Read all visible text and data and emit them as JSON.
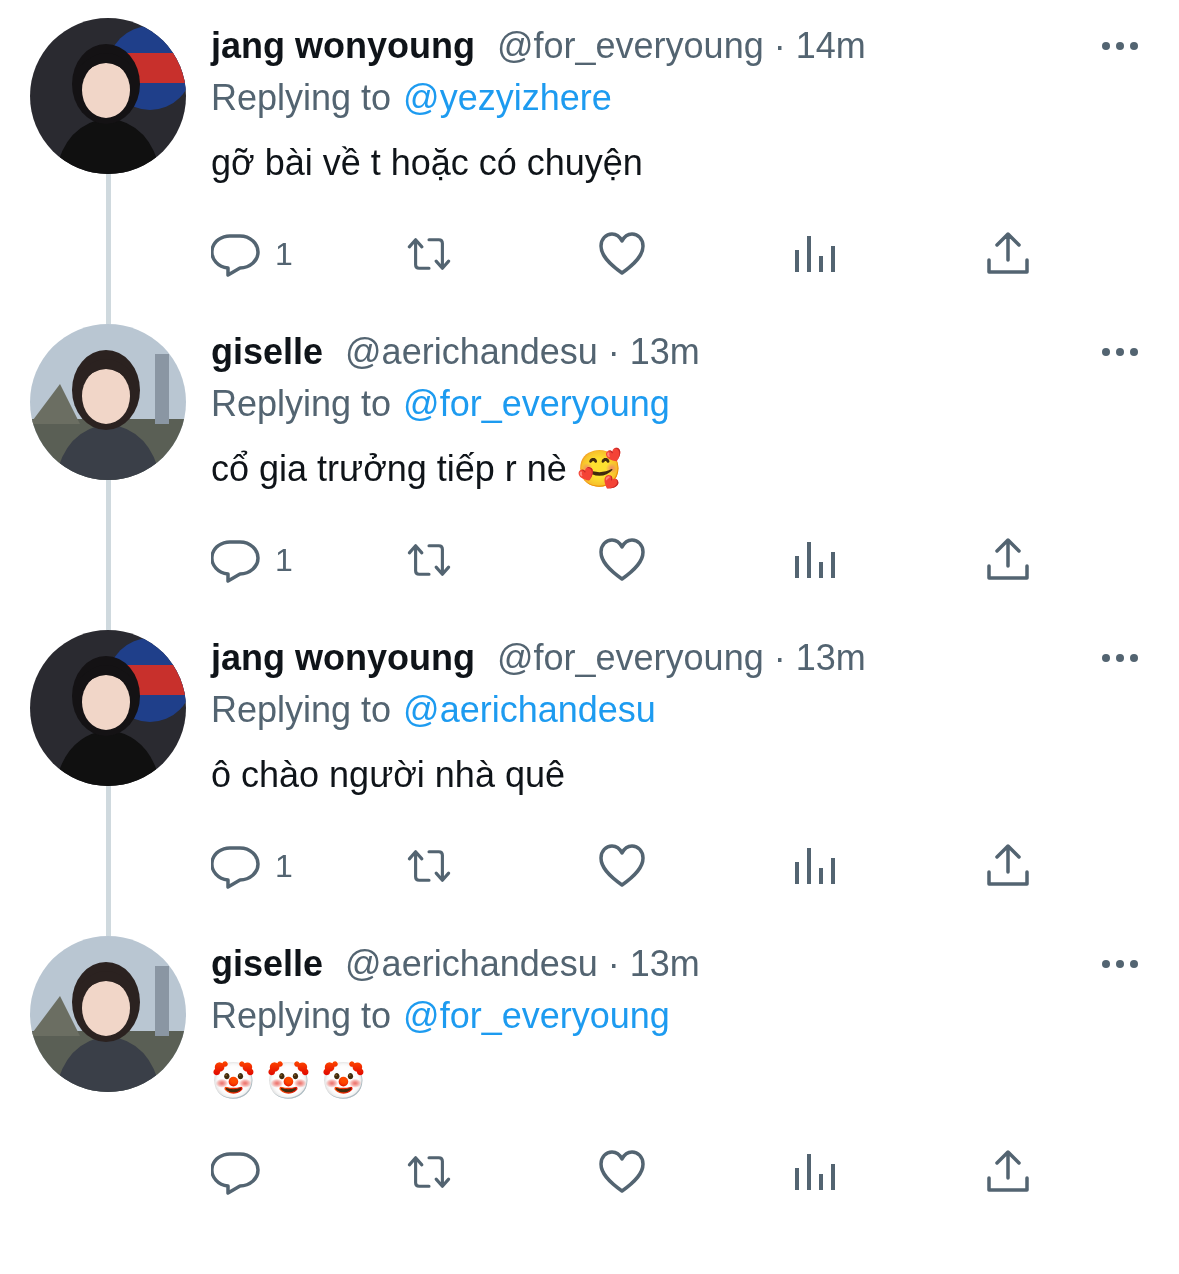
{
  "tweets": [
    {
      "name": "jang wonyoung",
      "handle": "@for_everyoung",
      "separator": "·",
      "time": "14m",
      "replying_label": "Replying to",
      "replying_to": "@yezyizhere",
      "text": "gỡ bài về t hoặc có chuyện",
      "reply_count": "1"
    },
    {
      "name": "giselle",
      "handle": "@aerichandesu",
      "separator": "·",
      "time": "13m",
      "replying_label": "Replying to",
      "replying_to": "@for_everyoung",
      "text": "cổ gia trưởng tiếp r nè 🥰",
      "reply_count": "1"
    },
    {
      "name": "jang wonyoung",
      "handle": "@for_everyoung",
      "separator": "·",
      "time": "13m",
      "replying_label": "Replying to",
      "replying_to": "@aerichandesu",
      "text": "ô chào người nhà quê",
      "reply_count": "1"
    },
    {
      "name": "giselle",
      "handle": "@aerichandesu",
      "separator": "·",
      "time": "13m",
      "replying_label": "Replying to",
      "replying_to": "@for_everyoung",
      "text": "🤡 🤡 🤡"
    }
  ]
}
